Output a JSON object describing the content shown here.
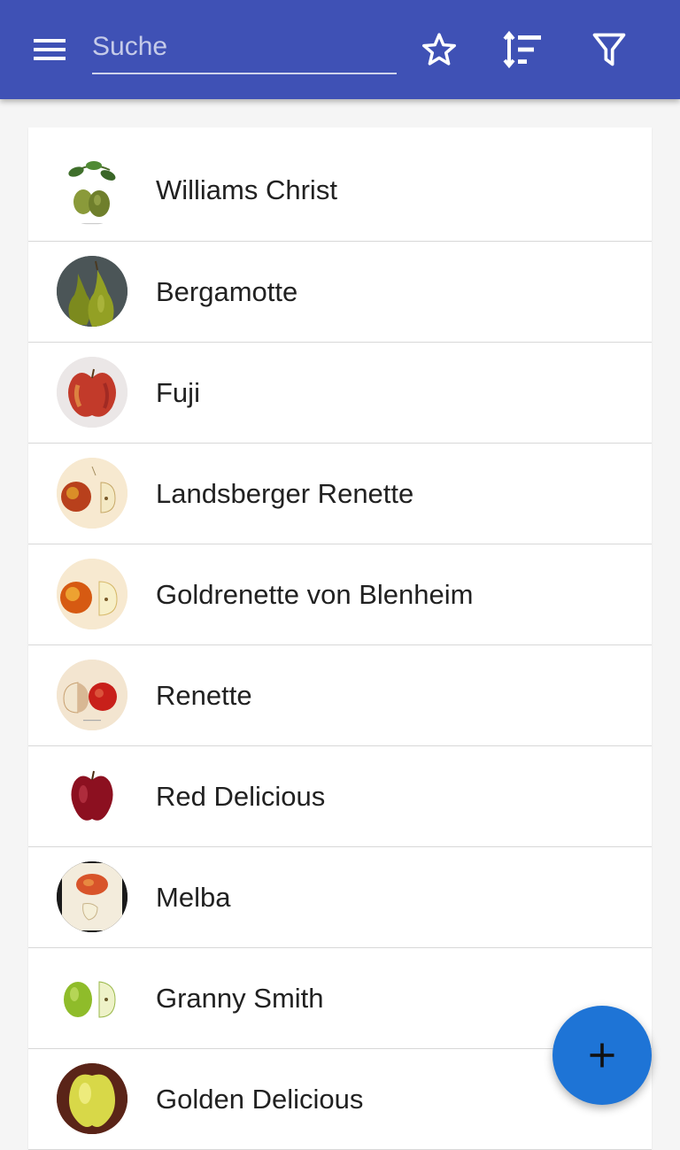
{
  "toolbar": {
    "search_placeholder": "Suche",
    "search_value": "",
    "icons": [
      "menu-icon",
      "star-icon",
      "sort-icon",
      "filter-icon"
    ],
    "background_color": "#3f51b5"
  },
  "list": {
    "items": [
      {
        "name": "Williams Christ",
        "thumb": "pear-illustration"
      },
      {
        "name": "Bergamotte",
        "thumb": "green-pears"
      },
      {
        "name": "Fuji",
        "thumb": "red-apple"
      },
      {
        "name": "Landsberger Renette",
        "thumb": "apple-illustration"
      },
      {
        "name": "Goldrenette von Blenheim",
        "thumb": "apple-illustration"
      },
      {
        "name": "Renette",
        "thumb": "apple-illustration"
      },
      {
        "name": "Red Delicious",
        "thumb": "dark-red-apple"
      },
      {
        "name": "Melba",
        "thumb": "apple-illustration"
      },
      {
        "name": "Granny Smith",
        "thumb": "green-apple"
      },
      {
        "name": "Golden Delicious",
        "thumb": "yellow-apple"
      }
    ]
  },
  "fab": {
    "icon": "plus-icon",
    "color": "#1e74d6"
  }
}
